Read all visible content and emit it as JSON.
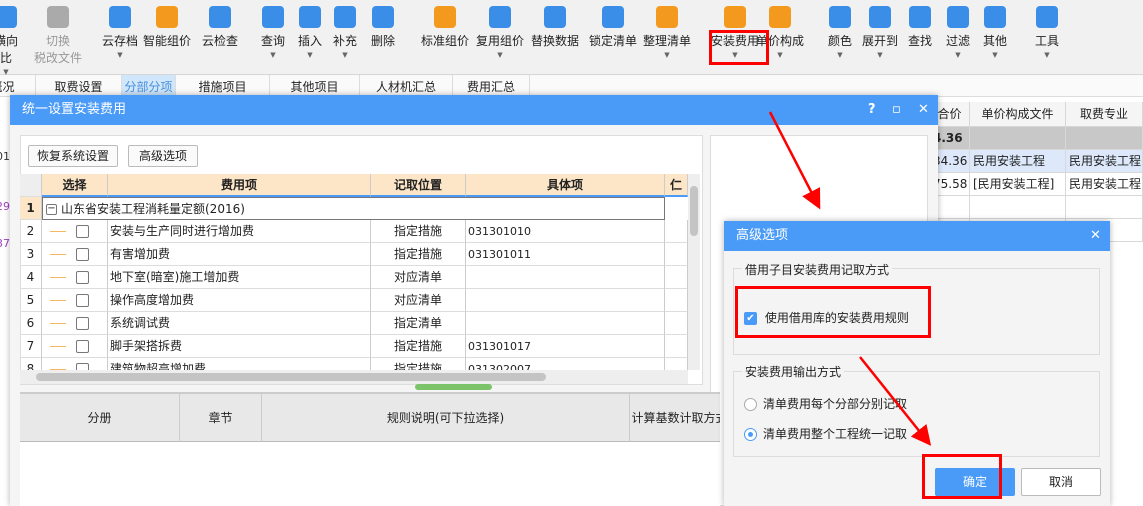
{
  "toolbar": {
    "items": [
      {
        "label": "横向",
        "label2": "比",
        "icon": "layout-icon",
        "color": "#3b8ee8",
        "dd": true
      },
      {
        "label": "切换",
        "label2": "税改文件",
        "icon": "tax-switch-icon",
        "color": "#aaaaaa",
        "disabled": true
      },
      {
        "label": "云存档",
        "icon": "cloud-upload-icon",
        "color": "#3b8ee8",
        "dd": true
      },
      {
        "label": "智能组价",
        "icon": "smart-price-icon",
        "color": "#f39a1e"
      },
      {
        "label": "云检查",
        "icon": "cloud-check-icon",
        "color": "#3b8ee8"
      },
      {
        "label": "查询",
        "icon": "query-icon",
        "color": "#3b8ee8",
        "dd": true
      },
      {
        "label": "插入",
        "icon": "insert-icon",
        "color": "#3b8ee8",
        "dd": true
      },
      {
        "label": "补充",
        "icon": "supplement-icon",
        "color": "#3b8ee8",
        "dd": true
      },
      {
        "label": "删除",
        "icon": "delete-icon",
        "color": "#3b8ee8"
      },
      {
        "label": "标准组价",
        "icon": "standard-price-icon",
        "color": "#f39a1e"
      },
      {
        "label": "复用组价",
        "icon": "reuse-price-icon",
        "color": "#3b8ee8",
        "dd": true
      },
      {
        "label": "替换数据",
        "icon": "replace-data-icon",
        "color": "#3b8ee8"
      },
      {
        "label": "锁定清单",
        "icon": "lock-icon",
        "color": "#3b8ee8"
      },
      {
        "label": "整理清单",
        "icon": "organize-list-icon",
        "color": "#f39a1e",
        "dd": true
      },
      {
        "label": "安装费用",
        "icon": "install-fee-icon",
        "color": "#f39a1e",
        "dd": true
      },
      {
        "label": "单价构成",
        "icon": "unit-price-icon",
        "color": "#f39a1e",
        "dd": true
      },
      {
        "label": "颜色",
        "icon": "color-icon",
        "color": "#3b8ee8",
        "dd": true
      },
      {
        "label": "展开到",
        "icon": "expand-icon",
        "color": "#3b8ee8",
        "dd": true
      },
      {
        "label": "查找",
        "icon": "find-icon",
        "color": "#3b8ee8"
      },
      {
        "label": "过滤",
        "icon": "filter-icon",
        "color": "#3b8ee8",
        "dd": true
      },
      {
        "label": "其他",
        "icon": "other-icon",
        "color": "#3b8ee8",
        "dd": true
      },
      {
        "label": "工具",
        "icon": "tools-icon",
        "color": "#3b8ee8",
        "dd": true
      }
    ]
  },
  "tabs": [
    "概况",
    "取费设置",
    "分部分项",
    "措施项目",
    "其他项目",
    "人材机汇总",
    "费用汇总"
  ],
  "active_tab": "分部分项",
  "background_grid": {
    "headers": [
      "合价",
      "单价构成文件",
      "取费专业"
    ],
    "rows": [
      [
        "4.36",
        "",
        ""
      ],
      [
        "34.36",
        "民用安装工程",
        "民用安装工程"
      ],
      [
        "75.58",
        "[民用安装工程]",
        "民用安装工程"
      ],
      [
        "",
        "",
        ""
      ],
      [
        "",
        "",
        "装工程"
      ]
    ],
    "left_edge": [
      "01",
      "29",
      "37"
    ]
  },
  "main_dialog": {
    "title": "统一设置安装费用",
    "restore_button": "恢复系统设置",
    "advanced_button": "高级选项",
    "columns": [
      "选择",
      "费用项",
      "记取位置",
      "具体项",
      "仁"
    ],
    "group_row": {
      "num": "1",
      "label": "山东省安装工程消耗量定额(2016)"
    },
    "rows": [
      {
        "num": "2",
        "name": "安装与生产同时进行增加费",
        "position": "指定措施",
        "item": "031301010"
      },
      {
        "num": "3",
        "name": "有害增加费",
        "position": "指定措施",
        "item": "031301011"
      },
      {
        "num": "4",
        "name": "地下室(暗室)施工增加费",
        "position": "对应清单",
        "item": ""
      },
      {
        "num": "5",
        "name": "操作高度增加费",
        "position": "对应清单",
        "item": ""
      },
      {
        "num": "6",
        "name": "系统调试费",
        "position": "指定清单",
        "item": ""
      },
      {
        "num": "7",
        "name": "脚手架搭拆费",
        "position": "指定措施",
        "item": "031301017"
      },
      {
        "num": "8",
        "name": "建筑物超高增加费",
        "position": "指定措施",
        "item": "031302007"
      }
    ],
    "bottom_columns": [
      "分册",
      "章节",
      "规则说明(可下拉选择)",
      "计算基数计取方式"
    ]
  },
  "advanced_dialog": {
    "title": "高级选项",
    "group1_label": "借用子目安装费用记取方式",
    "checkbox_label": "使用借用库的安装费用规则",
    "checkbox_checked": true,
    "group2_label": "安装费用输出方式",
    "radio_options": [
      "清单费用每个分部分别记取",
      "清单费用整个工程统一记取"
    ],
    "radio_selected": "清单费用整个工程统一记取",
    "ok": "确定",
    "cancel": "取消"
  },
  "colors": {
    "accent": "#4a9bf7",
    "header": "#fde6c8",
    "highlight": "#ff0000"
  }
}
